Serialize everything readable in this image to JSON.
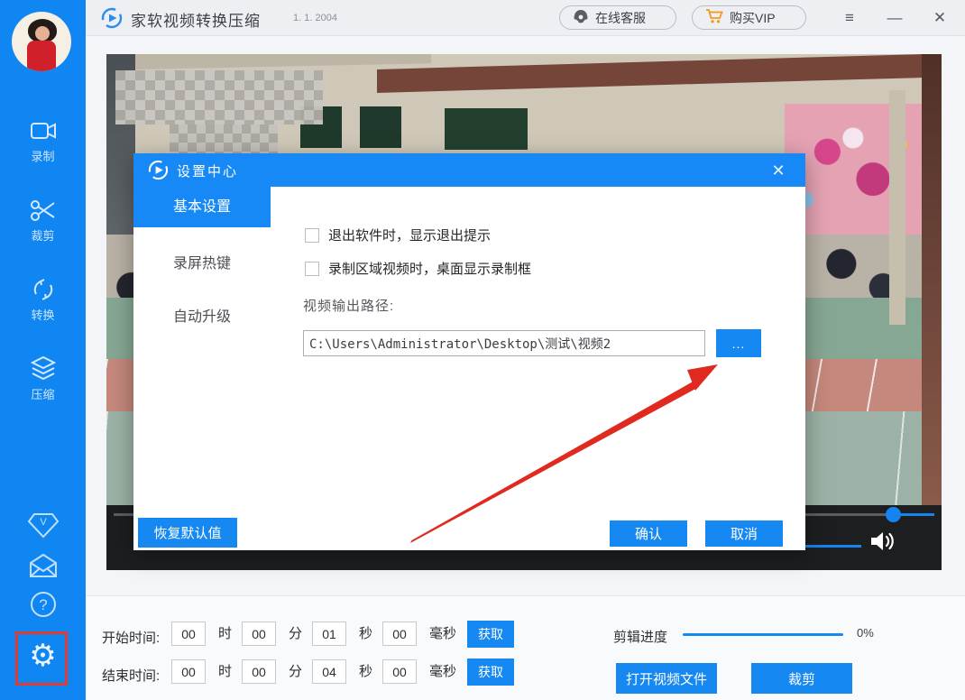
{
  "window": {
    "app_title": "家软视频转换压缩",
    "version": "1. 1. 2004",
    "support_label": "在线客服",
    "buy_vip_label": "购买VIP",
    "menu_glyph": "≡",
    "minimize_glyph": "—",
    "close_glyph": "✕"
  },
  "accent_colors": {
    "sidebar_blue": "#0f86f1",
    "dialog_blue": "#1689f6",
    "button_blue": "#1588f2",
    "vip_orange": "#f29b1d",
    "highlight_red": "#e23b31"
  },
  "sidebar": {
    "items": [
      {
        "icon": "record-camera-icon",
        "label": "录制"
      },
      {
        "icon": "cut-scissors-icon",
        "label": "裁剪"
      },
      {
        "icon": "convert-arrows-icon",
        "label": "转换"
      },
      {
        "icon": "compress-layers-icon",
        "label": "压缩"
      }
    ],
    "vip_glyph": "V",
    "help_glyph": "?",
    "gear_glyph": "⚙"
  },
  "dialog": {
    "title": "设置中心",
    "close_glyph": "✕",
    "tabs": [
      {
        "label": "基本设置"
      },
      {
        "label": "录屏热键"
      },
      {
        "label": "自动升级"
      }
    ],
    "checkbox_exit": "退出软件时，显示退出提示",
    "checkbox_record_frame": "录制区域视频时，桌面显示录制框",
    "output_path_label": "视频输出路径:",
    "output_path_value": "C:\\Users\\Administrator\\Desktop\\测试\\视频2",
    "browse_label": "...",
    "restore_defaults": "恢复默认值",
    "confirm": "确认",
    "cancel": "取消"
  },
  "trim_controls": {
    "start_label": "开始时间:",
    "end_label": "结束时间:",
    "unit_hour": "时",
    "unit_minute": "分",
    "unit_second": "秒",
    "unit_ms": "毫秒",
    "start": {
      "h": "00",
      "m": "00",
      "s": "01",
      "ms": "00"
    },
    "end": {
      "h": "00",
      "m": "00",
      "s": "04",
      "ms": "00"
    },
    "get_label": "获取",
    "progress_label": "剪辑进度",
    "progress_value": "0%",
    "open_file_label": "打开视频文件",
    "cut_label": "裁剪"
  }
}
